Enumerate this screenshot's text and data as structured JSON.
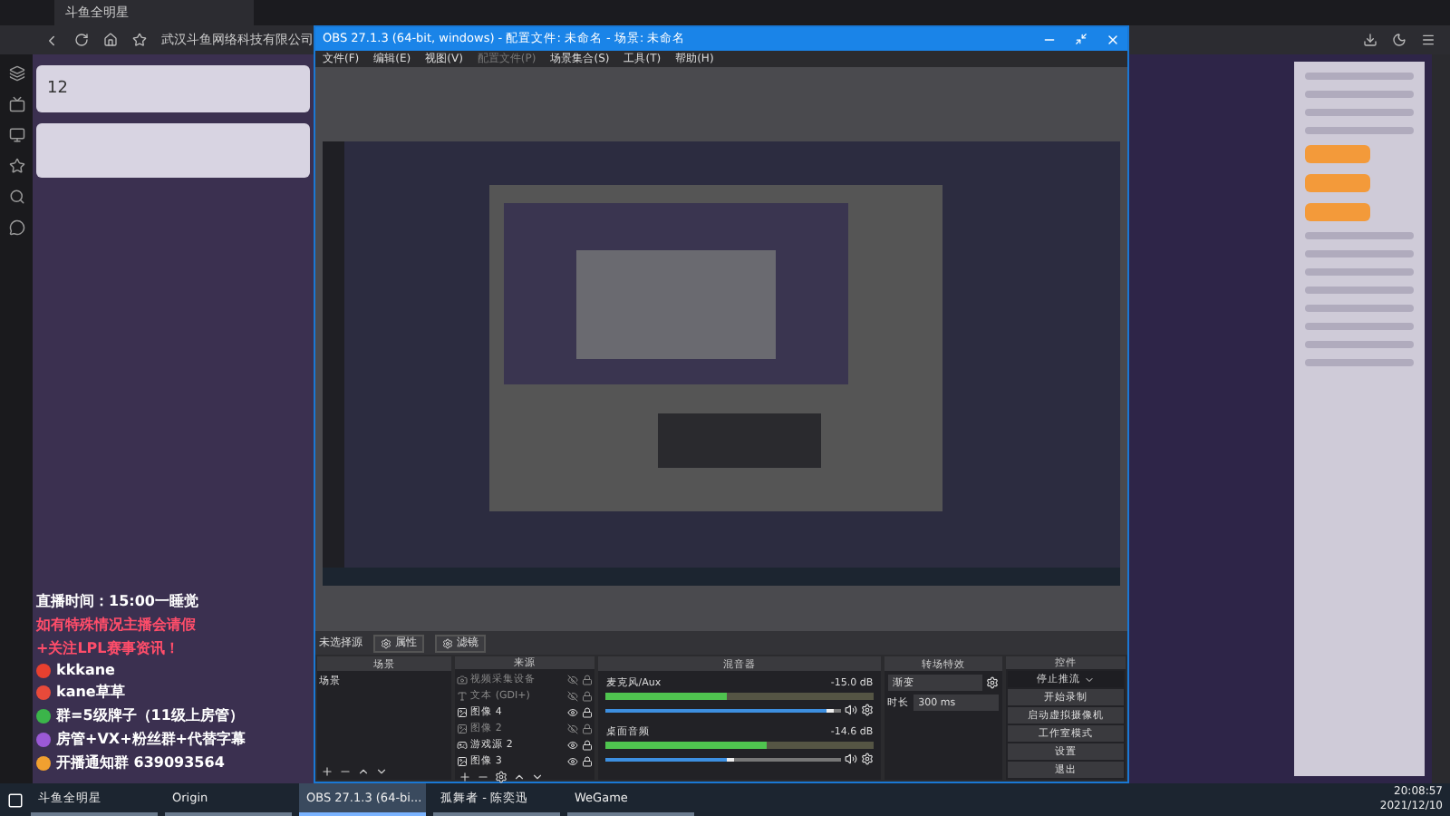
{
  "browser": {
    "tab": "斗鱼全明星",
    "address": "武汉斗鱼网络科技有限公司"
  },
  "page_left": {
    "count": "12"
  },
  "overlay": {
    "schedule": "直播时间：15:00一睡觉",
    "notice": [
      "如有特殊情况主播会请假",
      "+关注LPL赛事资讯！"
    ],
    "contacts": [
      {
        "kind": "douyu",
        "text": "kkkane"
      },
      {
        "kind": "weibo",
        "text": "kane草草"
      },
      {
        "kind": "wechat",
        "text": "群=5级牌子（11级上房管）"
      },
      {
        "kind": "fans",
        "text": "房管+VX+粉丝群+代替字幕"
      },
      {
        "kind": "notify",
        "text": "开播通知群 639093564"
      }
    ]
  },
  "obs": {
    "title": "OBS 27.1.3 (64-bit, windows) - 配置文件: 未命名 - 场景: 未命名",
    "menu": [
      {
        "label": "文件(F)",
        "disabled": false
      },
      {
        "label": "编辑(E)",
        "disabled": false
      },
      {
        "label": "视图(V)",
        "disabled": false
      },
      {
        "label": "配置文件(P)",
        "disabled": true
      },
      {
        "label": "场景集合(S)",
        "disabled": false
      },
      {
        "label": "工具(T)",
        "disabled": false
      },
      {
        "label": "帮助(H)",
        "disabled": false
      }
    ],
    "source_bar": {
      "label": "未选择源",
      "buttons": [
        "属性",
        "滤镜"
      ]
    },
    "scenes": {
      "title": "场景",
      "items": [
        "场景"
      ]
    },
    "sources": {
      "title": "来源",
      "items": [
        {
          "label": "视频采集设备",
          "kind": "camera",
          "visible": false
        },
        {
          "label": "文本 (GDI+)",
          "kind": "text",
          "visible": false
        },
        {
          "label": "图像 4",
          "kind": "image",
          "visible": true
        },
        {
          "label": "图像 2",
          "kind": "image",
          "visible": false
        },
        {
          "label": "游戏源 2",
          "kind": "game",
          "visible": true
        },
        {
          "label": "图像 3",
          "kind": "image",
          "visible": true
        }
      ]
    },
    "mixer": {
      "title": "混音器",
      "channels": [
        {
          "name": "麦克风/Aux",
          "reading": "-15.0 dB",
          "meter": {
            "level": 0.45
          },
          "volume": {
            "level": 0.97
          }
        },
        {
          "name": "桌面音频",
          "reading": "-14.6 dB",
          "meter": {
            "level": 0.6
          },
          "volume": {
            "level": 0.55
          }
        }
      ]
    },
    "transitions": {
      "title": "转场特效",
      "type": "渐变",
      "duration_label": "时长",
      "duration": "300 ms"
    },
    "controls": {
      "title": "控件",
      "buttons": [
        {
          "label": "停止推流",
          "kind": "dropdown"
        },
        {
          "label": "开始录制",
          "kind": "plain"
        },
        {
          "label": "启动虚拟摄像机",
          "kind": "plain"
        },
        {
          "label": "工作室模式",
          "kind": "plain"
        },
        {
          "label": "设置",
          "kind": "plain"
        },
        {
          "label": "退出",
          "kind": "plain"
        }
      ]
    }
  },
  "taskbar": {
    "items": [
      {
        "label": "斗鱼全明星",
        "selected": false
      },
      {
        "label": "Origin",
        "selected": false
      },
      {
        "label": "OBS 27.1.3 (64-bi...",
        "selected": true
      },
      {
        "label": "孤舞者 - 陈奕迅",
        "selected": false
      },
      {
        "label": "WeGame",
        "selected": false
      }
    ],
    "time": "20:08:57",
    "date": "2021/12/10"
  }
}
